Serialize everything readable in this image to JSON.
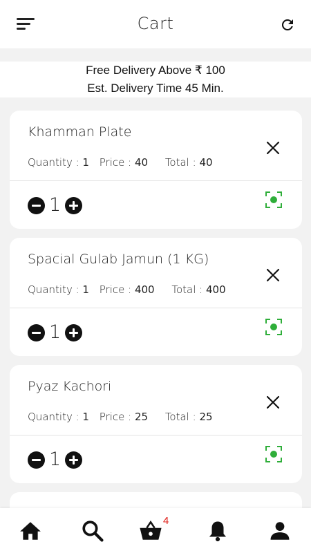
{
  "header": {
    "title": "Cart",
    "menu_icon": "sort-menu-icon",
    "refresh_icon": "refresh-icon"
  },
  "banner": {
    "line1": "Free Delivery Above ₹ 100",
    "line2": "Est. Delivery Time 45 Min."
  },
  "labels": {
    "quantity": "Quantity : ",
    "price": "Price : ",
    "total": "Total : "
  },
  "cart_items": [
    {
      "name": "Khamman Plate",
      "quantity": "1",
      "price": "40",
      "total": "40",
      "stepper_value": "1"
    },
    {
      "name": "Spacial Gulab Jamun (1 KG)",
      "quantity": "1",
      "price": "400",
      "total": "400",
      "stepper_value": "1"
    },
    {
      "name": "Pyaz Kachori",
      "quantity": "1",
      "price": "25",
      "total": "25",
      "stepper_value": "1"
    }
  ],
  "bottom_nav": {
    "items": [
      "home-icon",
      "search-icon",
      "cart-basket-icon",
      "notification-bell-icon",
      "profile-icon"
    ],
    "cart_badge": "4"
  },
  "colors": {
    "veg_green": "#2fae3a",
    "badge_red": "#e0201a",
    "background": "#f2f2f2"
  }
}
